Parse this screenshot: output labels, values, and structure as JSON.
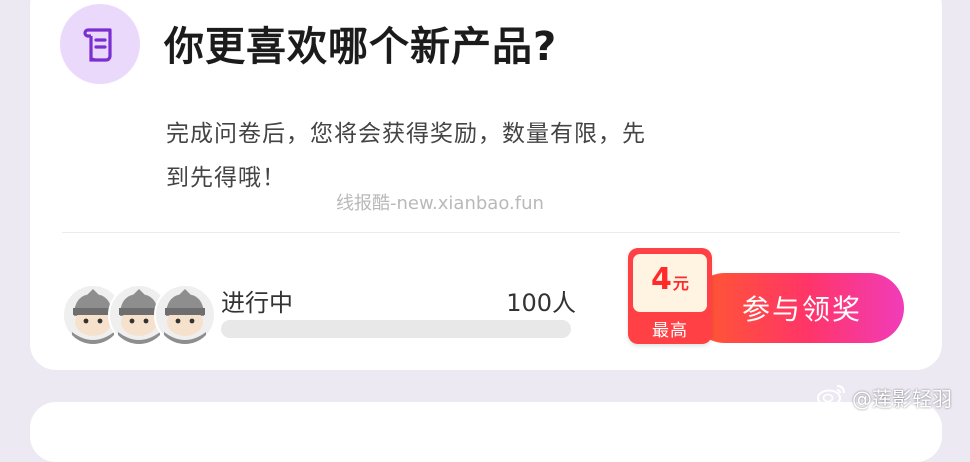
{
  "survey": {
    "title": "你更喜欢哪个新产品?",
    "description": "完成问卷后，您将会获得奖励，数量有限，先到先得哦！",
    "status": "进行中",
    "participants": "100人",
    "progress_fraction": 0,
    "reward": {
      "amount": "4",
      "unit": "元",
      "caption": "最高"
    },
    "join_label": "参与领奖"
  },
  "overlay": {
    "watermark": "线报酷-new.xianbao.fun",
    "credit": "@莲影轻羽"
  },
  "icons": {
    "header": "survey-scroll-icon",
    "avatar": "ninja-avatar-icon",
    "credit": "weibo-icon"
  },
  "colors": {
    "accent": "#ff3568",
    "icon_bg": "#ead9fb",
    "icon_fg": "#7a2fd0",
    "badge": "#ff4044"
  }
}
